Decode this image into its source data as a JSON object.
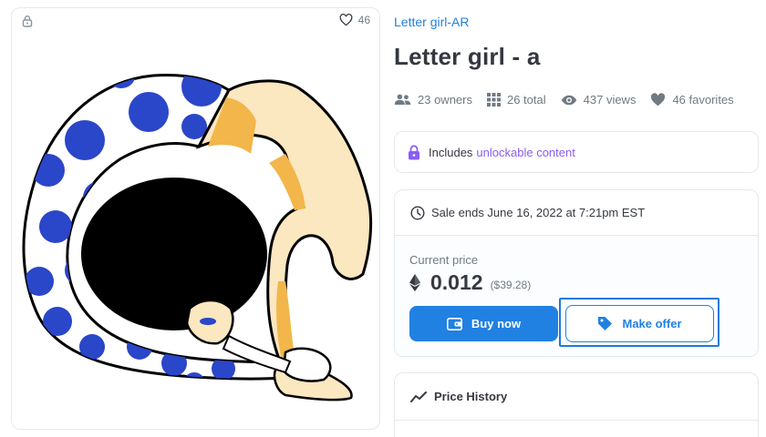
{
  "artwork": {
    "favorites_count": "46",
    "colors": {
      "blue": "#2a46c9",
      "skin": "#fbe7c0",
      "shade": "#f2b64a",
      "black": "#000000"
    },
    "icons": {
      "lock": "lock-icon",
      "heart": "heart-outline-icon"
    }
  },
  "collection": {
    "name": "Letter girl-AR"
  },
  "item": {
    "title": "Letter girl - a"
  },
  "stats": [
    {
      "icon": "people-icon",
      "label": "23 owners"
    },
    {
      "icon": "grid-icon",
      "label": "26 total"
    },
    {
      "icon": "eye-icon",
      "label": "437 views"
    },
    {
      "icon": "heart-icon",
      "label": "46 favorites"
    }
  ],
  "unlockable": {
    "prefix": "Includes",
    "highlight": "unlockable content"
  },
  "sale": {
    "ends_text": "Sale ends June 16, 2022 at 7:21pm EST",
    "current_price_label": "Current price",
    "price_eth": "0.012",
    "price_usd": "($39.28)",
    "buy_label": "Buy now",
    "offer_label": "Make offer"
  },
  "history": {
    "title": "Price History"
  },
  "theme": {
    "accent": "#2081e2",
    "purple": "#8b5cf6",
    "text": "#353840",
    "muted": "#707a83",
    "border": "#e5e8eb"
  }
}
